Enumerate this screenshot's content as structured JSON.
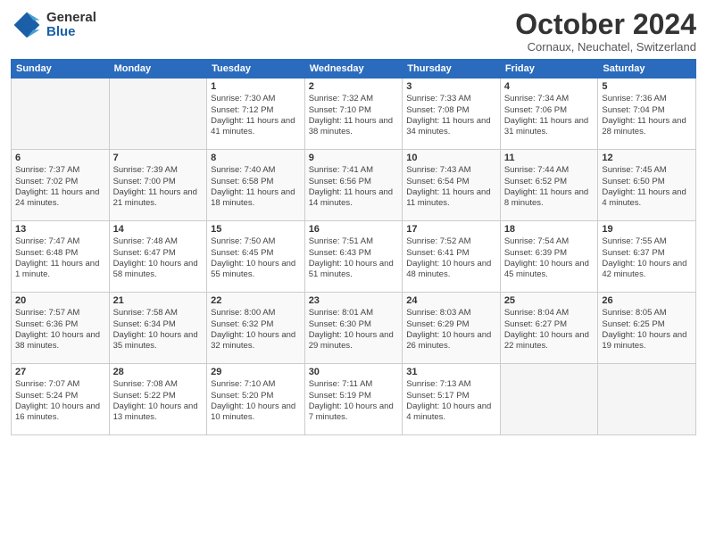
{
  "logo": {
    "general": "General",
    "blue": "Blue"
  },
  "header": {
    "month": "October 2024",
    "location": "Cornaux, Neuchatel, Switzerland"
  },
  "days_of_week": [
    "Sunday",
    "Monday",
    "Tuesday",
    "Wednesday",
    "Thursday",
    "Friday",
    "Saturday"
  ],
  "weeks": [
    [
      {
        "empty": true
      },
      {
        "empty": true
      },
      {
        "day": "1",
        "sunrise": "Sunrise: 7:30 AM",
        "sunset": "Sunset: 7:12 PM",
        "daylight": "Daylight: 11 hours and 41 minutes."
      },
      {
        "day": "2",
        "sunrise": "Sunrise: 7:32 AM",
        "sunset": "Sunset: 7:10 PM",
        "daylight": "Daylight: 11 hours and 38 minutes."
      },
      {
        "day": "3",
        "sunrise": "Sunrise: 7:33 AM",
        "sunset": "Sunset: 7:08 PM",
        "daylight": "Daylight: 11 hours and 34 minutes."
      },
      {
        "day": "4",
        "sunrise": "Sunrise: 7:34 AM",
        "sunset": "Sunset: 7:06 PM",
        "daylight": "Daylight: 11 hours and 31 minutes."
      },
      {
        "day": "5",
        "sunrise": "Sunrise: 7:36 AM",
        "sunset": "Sunset: 7:04 PM",
        "daylight": "Daylight: 11 hours and 28 minutes."
      }
    ],
    [
      {
        "day": "6",
        "sunrise": "Sunrise: 7:37 AM",
        "sunset": "Sunset: 7:02 PM",
        "daylight": "Daylight: 11 hours and 24 minutes."
      },
      {
        "day": "7",
        "sunrise": "Sunrise: 7:39 AM",
        "sunset": "Sunset: 7:00 PM",
        "daylight": "Daylight: 11 hours and 21 minutes."
      },
      {
        "day": "8",
        "sunrise": "Sunrise: 7:40 AM",
        "sunset": "Sunset: 6:58 PM",
        "daylight": "Daylight: 11 hours and 18 minutes."
      },
      {
        "day": "9",
        "sunrise": "Sunrise: 7:41 AM",
        "sunset": "Sunset: 6:56 PM",
        "daylight": "Daylight: 11 hours and 14 minutes."
      },
      {
        "day": "10",
        "sunrise": "Sunrise: 7:43 AM",
        "sunset": "Sunset: 6:54 PM",
        "daylight": "Daylight: 11 hours and 11 minutes."
      },
      {
        "day": "11",
        "sunrise": "Sunrise: 7:44 AM",
        "sunset": "Sunset: 6:52 PM",
        "daylight": "Daylight: 11 hours and 8 minutes."
      },
      {
        "day": "12",
        "sunrise": "Sunrise: 7:45 AM",
        "sunset": "Sunset: 6:50 PM",
        "daylight": "Daylight: 11 hours and 4 minutes."
      }
    ],
    [
      {
        "day": "13",
        "sunrise": "Sunrise: 7:47 AM",
        "sunset": "Sunset: 6:48 PM",
        "daylight": "Daylight: 11 hours and 1 minute."
      },
      {
        "day": "14",
        "sunrise": "Sunrise: 7:48 AM",
        "sunset": "Sunset: 6:47 PM",
        "daylight": "Daylight: 10 hours and 58 minutes."
      },
      {
        "day": "15",
        "sunrise": "Sunrise: 7:50 AM",
        "sunset": "Sunset: 6:45 PM",
        "daylight": "Daylight: 10 hours and 55 minutes."
      },
      {
        "day": "16",
        "sunrise": "Sunrise: 7:51 AM",
        "sunset": "Sunset: 6:43 PM",
        "daylight": "Daylight: 10 hours and 51 minutes."
      },
      {
        "day": "17",
        "sunrise": "Sunrise: 7:52 AM",
        "sunset": "Sunset: 6:41 PM",
        "daylight": "Daylight: 10 hours and 48 minutes."
      },
      {
        "day": "18",
        "sunrise": "Sunrise: 7:54 AM",
        "sunset": "Sunset: 6:39 PM",
        "daylight": "Daylight: 10 hours and 45 minutes."
      },
      {
        "day": "19",
        "sunrise": "Sunrise: 7:55 AM",
        "sunset": "Sunset: 6:37 PM",
        "daylight": "Daylight: 10 hours and 42 minutes."
      }
    ],
    [
      {
        "day": "20",
        "sunrise": "Sunrise: 7:57 AM",
        "sunset": "Sunset: 6:36 PM",
        "daylight": "Daylight: 10 hours and 38 minutes."
      },
      {
        "day": "21",
        "sunrise": "Sunrise: 7:58 AM",
        "sunset": "Sunset: 6:34 PM",
        "daylight": "Daylight: 10 hours and 35 minutes."
      },
      {
        "day": "22",
        "sunrise": "Sunrise: 8:00 AM",
        "sunset": "Sunset: 6:32 PM",
        "daylight": "Daylight: 10 hours and 32 minutes."
      },
      {
        "day": "23",
        "sunrise": "Sunrise: 8:01 AM",
        "sunset": "Sunset: 6:30 PM",
        "daylight": "Daylight: 10 hours and 29 minutes."
      },
      {
        "day": "24",
        "sunrise": "Sunrise: 8:03 AM",
        "sunset": "Sunset: 6:29 PM",
        "daylight": "Daylight: 10 hours and 26 minutes."
      },
      {
        "day": "25",
        "sunrise": "Sunrise: 8:04 AM",
        "sunset": "Sunset: 6:27 PM",
        "daylight": "Daylight: 10 hours and 22 minutes."
      },
      {
        "day": "26",
        "sunrise": "Sunrise: 8:05 AM",
        "sunset": "Sunset: 6:25 PM",
        "daylight": "Daylight: 10 hours and 19 minutes."
      }
    ],
    [
      {
        "day": "27",
        "sunrise": "Sunrise: 7:07 AM",
        "sunset": "Sunset: 5:24 PM",
        "daylight": "Daylight: 10 hours and 16 minutes."
      },
      {
        "day": "28",
        "sunrise": "Sunrise: 7:08 AM",
        "sunset": "Sunset: 5:22 PM",
        "daylight": "Daylight: 10 hours and 13 minutes."
      },
      {
        "day": "29",
        "sunrise": "Sunrise: 7:10 AM",
        "sunset": "Sunset: 5:20 PM",
        "daylight": "Daylight: 10 hours and 10 minutes."
      },
      {
        "day": "30",
        "sunrise": "Sunrise: 7:11 AM",
        "sunset": "Sunset: 5:19 PM",
        "daylight": "Daylight: 10 hours and 7 minutes."
      },
      {
        "day": "31",
        "sunrise": "Sunrise: 7:13 AM",
        "sunset": "Sunset: 5:17 PM",
        "daylight": "Daylight: 10 hours and 4 minutes."
      },
      {
        "empty": true
      },
      {
        "empty": true
      }
    ]
  ]
}
